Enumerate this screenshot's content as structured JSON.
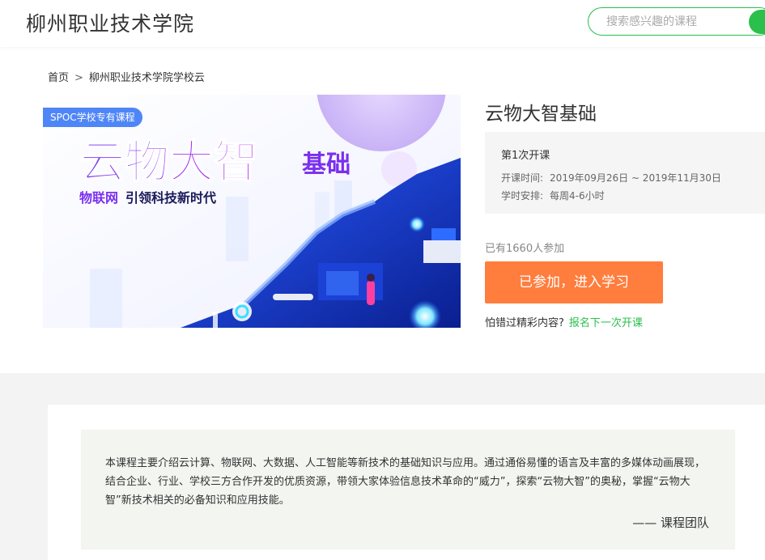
{
  "header": {
    "school_name": "柳州职业技术学院",
    "search_placeholder": "搜索感兴趣的课程"
  },
  "breadcrumb": {
    "home": "首页",
    "separator": ">",
    "current": "柳州职业技术学院学校云"
  },
  "banner": {
    "tag": "SPOC学校专有课程",
    "headline": "云物大智",
    "headline_suffix": "基础",
    "tagline_highlight": "物联网",
    "tagline_rest": "引领科技新时代"
  },
  "course": {
    "title": "云物大智基础",
    "session_label": "第1次开课",
    "time_label": "开课时间:",
    "time_value": "2019年09月26日 ~ 2019年11月30日",
    "schedule_label": "学时安排:",
    "schedule_value": "每周4-6小时",
    "enrolled_text": "已有1660人参加",
    "join_button": "已参加，进入学习",
    "miss_text": "怕错过精彩内容?",
    "next_link": "报名下一次开课"
  },
  "description": {
    "text": "本课程主要介绍云计算、物联网、大数据、人工智能等新技术的基础知识与应用。通过通俗易懂的语言及丰富的多媒体动画展现，结合企业、行业、学校三方合作开发的优质资源，带领大家体验信息技术革命的“威力”，探索“云物大智”的奥秘，掌握“云物大智”新技术相关的必备知识和应用技能。",
    "signature": "—— 课程团队"
  },
  "colors": {
    "accent_green": "#2ac04b",
    "join_orange": "#ff7d3d",
    "tag_blue": "#4f86f7"
  }
}
